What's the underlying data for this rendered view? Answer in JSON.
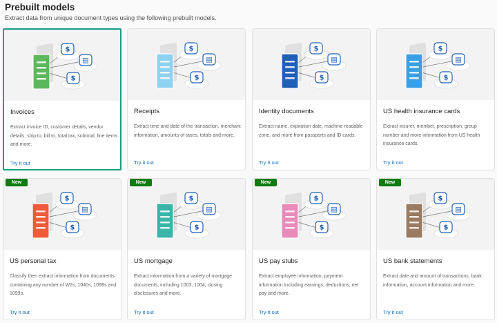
{
  "page": {
    "title": "Prebuilt models",
    "subtitle": "Extract data from unique document types using the following prebuilt models."
  },
  "colors": {
    "accent": "#1b9c85",
    "badge": "#107c10",
    "link": "#0f6cbd"
  },
  "cards": [
    {
      "name": "Invoices",
      "description": "Extract invoice ID, customer details, vendor details, ship to, bill to, total tax, subtotal, line items and more.",
      "link": "Try it out",
      "badge": "",
      "selected": true,
      "doc_color": "#5cb85c",
      "icon": "invoice-icon"
    },
    {
      "name": "Receipts",
      "description": "Extract time and date of the transaction, merchant information, amounts of taxes, totals and more.",
      "link": "Try it out",
      "badge": "",
      "selected": false,
      "doc_color": "#8fd1f0",
      "icon": "receipt-icon"
    },
    {
      "name": "Identity documents",
      "description": "Extract name, expiration date, machine readable zone, and more from passports and ID cards.",
      "link": "Try it out",
      "badge": "",
      "selected": false,
      "doc_color": "#1f5fb8",
      "icon": "passport-icon"
    },
    {
      "name": "US health insurance cards",
      "description": "Extract insurer, member, prescription, group number and more information from US health insurance cards.",
      "link": "Try it out",
      "badge": "",
      "selected": false,
      "doc_color": "#3aa0e6",
      "icon": "health-card-icon"
    },
    {
      "name": "US personal tax",
      "description": "Classify then extract information from documents containing any number of W2s, 1040s, 1098s and 1099s.",
      "link": "Try it out",
      "badge": "New",
      "selected": false,
      "doc_color": "#f05a3a",
      "icon": "tax-form-icon"
    },
    {
      "name": "US mortgage",
      "description": "Extract information from a variety of mortgage documents, including 1003, 1004, closing disclosures and more.",
      "link": "Try it out",
      "badge": "New",
      "selected": false,
      "doc_color": "#3ab5a8",
      "icon": "mortgage-doc-icon"
    },
    {
      "name": "US pay stubs",
      "description": "Extract employee information, payment information including earnings, deductions, net pay and more.",
      "link": "Try it out",
      "badge": "New",
      "selected": false,
      "doc_color": "#e88bb8",
      "icon": "pay-stub-icon"
    },
    {
      "name": "US bank statements",
      "description": "Extract date and amount of transactions, bank information, account information and more.",
      "link": "Try it out",
      "badge": "New",
      "selected": false,
      "doc_color": "#9a7a60",
      "icon": "bank-statement-icon"
    }
  ]
}
